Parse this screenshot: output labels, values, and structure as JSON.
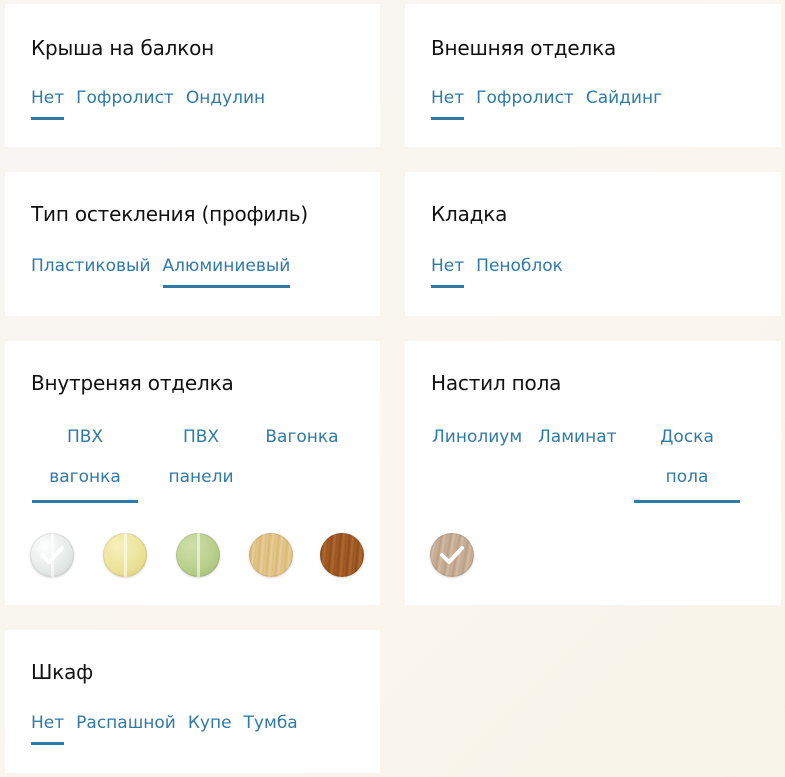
{
  "roof": {
    "title": "Крыша на балкон",
    "options": [
      "Нет",
      "Гофролист",
      "Ондулин"
    ],
    "selected": "Нет"
  },
  "exterior": {
    "title": "Внешняя отделка",
    "options": [
      "Нет",
      "Гофролист",
      "Сайдинг"
    ],
    "selected": "Нет"
  },
  "glazing": {
    "title": "Тип остекления (профиль)",
    "options": [
      "Пластиковый",
      "Алюминиевый"
    ],
    "selected": "Алюминиевый"
  },
  "masonry": {
    "title": "Кладка",
    "options": [
      "Нет",
      "Пеноблок"
    ],
    "selected": "Нет"
  },
  "interior": {
    "title": "Внутреняя отделка",
    "options": [
      {
        "line1": "ПВХ",
        "line2": "вагонка"
      },
      {
        "line1": "ПВХ",
        "line2": "панели"
      },
      {
        "line1": "Вагонка",
        "line2": ""
      }
    ],
    "selected": "ПВХ вагонка",
    "swatches": [
      {
        "name": "white",
        "color": "#e9ecea",
        "selected": true
      },
      {
        "name": "cream",
        "color": "#ece39a",
        "selected": false
      },
      {
        "name": "green",
        "color": "#b9cf8c",
        "selected": false
      },
      {
        "name": "light-wood",
        "color": "#e1c488",
        "selected": false
      },
      {
        "name": "dark-wood",
        "color": "#a65e26",
        "selected": false
      }
    ]
  },
  "flooring": {
    "title": "Настил пола",
    "options": [
      {
        "line1": "Линолиум",
        "line2": ""
      },
      {
        "line1": "Ламинат",
        "line2": ""
      },
      {
        "line1": "Доска",
        "line2": "пола"
      }
    ],
    "selected": "Доска пола",
    "swatches": [
      {
        "name": "bleached-oak",
        "color": "#c8ae94",
        "selected": true
      }
    ]
  },
  "wardrobe": {
    "title": "Шкаф",
    "options": [
      "Нет",
      "Распашной",
      "Купе",
      "Тумба"
    ],
    "selected": "Нет"
  },
  "colors": {
    "accent": "#2f7aa7",
    "title": "#111111",
    "card": "#ffffff"
  }
}
